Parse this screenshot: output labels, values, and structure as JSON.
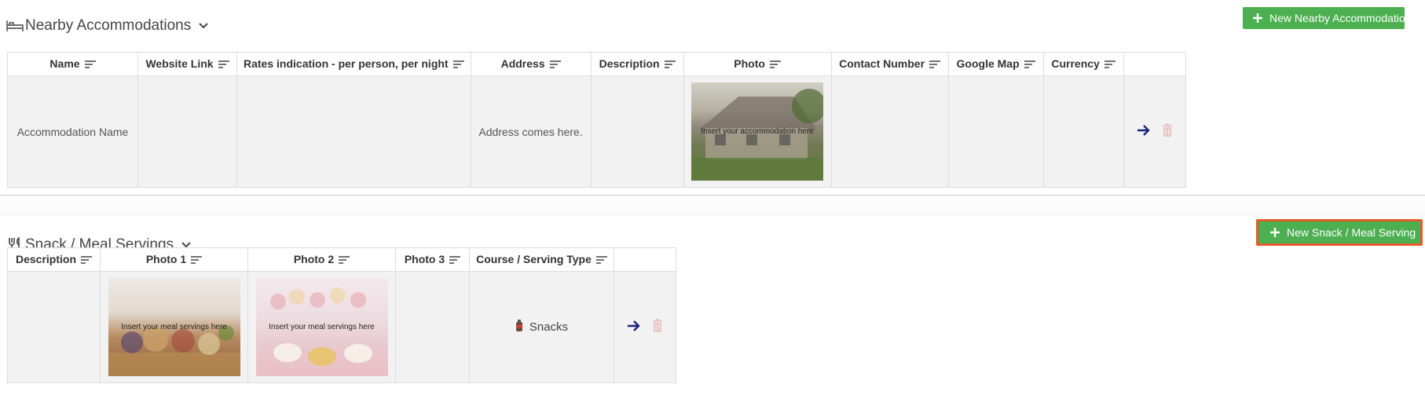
{
  "accommodations": {
    "title": "Nearby Accommodations",
    "add_button_label": "New Nearby Accommodation",
    "columns": [
      "Name",
      "Website Link",
      "Rates indication - per person, per night",
      "Address",
      "Description",
      "Photo",
      "Contact Number",
      "Google Map",
      "Currency"
    ],
    "row": {
      "name": "Accommodation Name",
      "website_link": "",
      "rates": "",
      "address": "Address comes here.",
      "description": "",
      "photo_caption": "Insert your accommodation here",
      "contact_number": "",
      "google_map": "",
      "currency": ""
    }
  },
  "meals": {
    "title": "Snack / Meal Servings",
    "add_button_label": "New Snack / Meal Serving",
    "columns": [
      "Description",
      "Photo 1",
      "Photo 2",
      "Photo 3",
      "Course / Serving Type"
    ],
    "row": {
      "description": "",
      "photo1_caption": "Insert your meal servings here",
      "photo2_caption": "Insert your meal servings here",
      "photo3_caption": "",
      "serving_type": "Snacks"
    }
  },
  "colors": {
    "add_button": "#4caf50",
    "focused_outline": "#e65c2e",
    "arrow_icon": "#1a237e",
    "trash_icon": "#e8c4c4"
  }
}
